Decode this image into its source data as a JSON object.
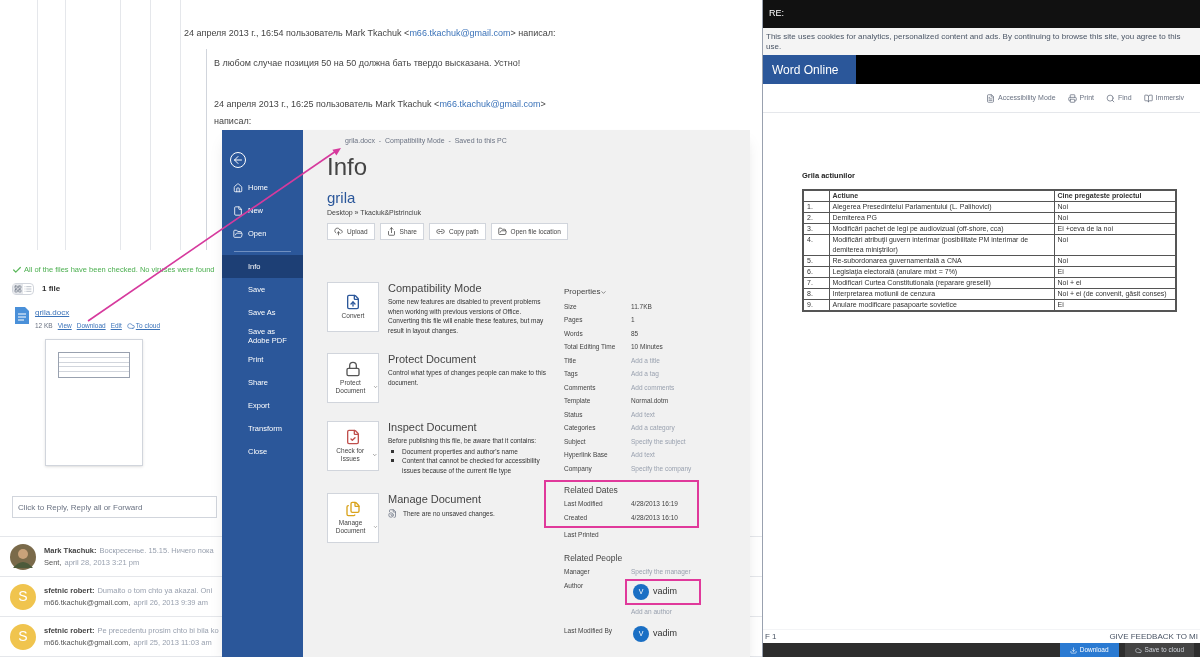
{
  "email_thread": {
    "header_1": {
      "prefix": "24 апреля 2013 г., 16:54 пользователь Mark Tkachuk <",
      "link": "m66.tkachuk@gmail.com",
      "suffix": "> написал:"
    },
    "quote": "В любом случае позиция 50 на 50 должна бать твердо высказана. Устно!",
    "header_2": {
      "prefix": "24 апреля 2013 г., 16:25 пользователь Mark Tkachuk <",
      "link": "m66.tkachuk@gmail.com",
      "suffix": ">"
    },
    "header_2_tail": "написал:"
  },
  "attachments": {
    "scan_notice": "All of the files have been checked. No viruses were found",
    "count": "1 file",
    "files": [
      {
        "name": "grila.docx",
        "size": "12 KB",
        "actions": [
          {
            "label": "View",
            "kind": "link"
          },
          {
            "label": "Download",
            "kind": "link"
          },
          {
            "label": "Edit",
            "kind": "link"
          },
          {
            "label": "To cloud",
            "kind": "cloud"
          }
        ]
      }
    ]
  },
  "reply": {
    "placeholder": "Click to Reply, Reply all or Forward"
  },
  "messages": [
    {
      "sender": "Mark Tkachuk:",
      "snippet": "Воскресенье. 15.15. Ничего пока",
      "meta_label": "Sent,",
      "date": "april 28, 2013 3:21 pm",
      "avatar": {
        "kind": "photo"
      }
    },
    {
      "sender": "sfetnic robert:",
      "snippet": "Dumaito o tom chto ya akazal. Oni",
      "meta_label": "m66.tkachuk@gmail.com,",
      "date": "april 26, 2013 9:39 am",
      "avatar": {
        "kind": "letter",
        "letter": "S"
      }
    },
    {
      "sender": "sfetnic robert:",
      "snippet": "Pe precedentu prosim chto bi bila ko",
      "meta_label": "m66.tkachuk@gmail.com,",
      "date": "april 25, 2013 11:03 am",
      "avatar": {
        "kind": "letter",
        "letter": "S"
      }
    }
  ],
  "backstage": {
    "title_bar": "grila.docx  -  Compatibility Mode  -  Saved to this PC",
    "nav_top": [
      {
        "label": "Home"
      },
      {
        "label": "New"
      },
      {
        "label": "Open"
      }
    ],
    "nav": [
      {
        "label": "Info",
        "selected": true
      },
      {
        "label": "Save",
        "selected": false
      },
      {
        "label": "Save As",
        "selected": false
      },
      {
        "label": "Save as Adobe PDF",
        "selected": false
      },
      {
        "label": "Print",
        "selected": false
      },
      {
        "label": "Share",
        "selected": false
      },
      {
        "label": "Export",
        "selected": false
      },
      {
        "label": "Transform",
        "selected": false
      },
      {
        "label": "Close",
        "selected": false
      }
    ],
    "heading": "Info",
    "doc_name": "grila",
    "path": "Desktop » Tkaciuk&Pistrinciuk",
    "actions": [
      {
        "label": "Upload"
      },
      {
        "label": "Share"
      },
      {
        "label": "Copy path"
      },
      {
        "label": "Open file location"
      }
    ],
    "sections": [
      {
        "kind": "convert",
        "button_label": "Convert",
        "has_menu": false,
        "title": "Compatibility Mode",
        "body": "Some new features are disabled to prevent problems when working with previous versions of Office. Converting this file will enable these features, but may result in layout changes."
      },
      {
        "kind": "protect",
        "button_label": "Protect Document",
        "has_menu": true,
        "title": "Protect Document",
        "body": "Control what types of changes people can make to this document."
      },
      {
        "kind": "inspect",
        "button_label": "Check for Issues",
        "has_menu": true,
        "title": "Inspect Document",
        "body": "Before publishing this file, be aware that it contains:",
        "bullets": [
          "Document properties and author's name",
          "Content that cannot be checked for accessibility issues because of the current file type"
        ]
      },
      {
        "kind": "manage",
        "button_label": "Manage Document",
        "has_menu": true,
        "title": "Manage Document",
        "note": "There are no unsaved changes."
      }
    ],
    "properties": {
      "heading": "Properties",
      "has_menu": true,
      "rows": [
        {
          "label": "Size",
          "value": "11.7KB",
          "empty": false
        },
        {
          "label": "Pages",
          "value": "1",
          "empty": false
        },
        {
          "label": "Words",
          "value": "85",
          "empty": false
        },
        {
          "label": "Total Editing Time",
          "value": "10 Minutes",
          "empty": false
        },
        {
          "label": "Title",
          "value": "Add a title",
          "empty": true
        },
        {
          "label": "Tags",
          "value": "Add a tag",
          "empty": true
        },
        {
          "label": "Comments",
          "value": "Add comments",
          "empty": true
        },
        {
          "label": "Template",
          "value": "Normal.dotm",
          "empty": false
        },
        {
          "label": "Status",
          "value": "Add text",
          "empty": true
        },
        {
          "label": "Categories",
          "value": "Add a category",
          "empty": true
        },
        {
          "label": "Subject",
          "value": "Specify the subject",
          "empty": true
        },
        {
          "label": "Hyperlink Base",
          "value": "Add text",
          "empty": true
        },
        {
          "label": "Company",
          "value": "Specify the company",
          "empty": true
        }
      ]
    },
    "related_dates": {
      "heading": "Related Dates",
      "highlighted": true,
      "rows": [
        {
          "label": "Last Modified",
          "value": "4/28/2013 16:19"
        },
        {
          "label": "Created",
          "value": "4/28/2013 16:10"
        }
      ],
      "last_printed": "Last Printed"
    },
    "related_people": {
      "heading": "Related People",
      "manager_label": "Manager",
      "manager_value": "Specify the manager",
      "author_label": "Author",
      "author": {
        "initial": "V",
        "name": "vadim",
        "highlighted": true
      },
      "add_author": "Add an author",
      "modified_by_label": "Last Modified By",
      "modified_by": {
        "initial": "V",
        "name": "vadim"
      }
    }
  },
  "word_online": {
    "title": "RE:",
    "cookie_notice": "This site uses cookies for analytics, personalized content and ads. By continuing to browse this site, you agree to this use.",
    "brand": "Word Online",
    "toolbar": [
      {
        "label": "Accessibility Mode"
      },
      {
        "label": "Print"
      },
      {
        "label": "Find"
      },
      {
        "label": "Immersiv"
      }
    ],
    "document": {
      "title": "Grila actiunilor",
      "columns": [
        "Actiune",
        "Cine pregateste proiectul"
      ],
      "rows": [
        {
          "number": "1.",
          "action": "Alegerea Presedintelui Parlamentului (L. Palihovici)",
          "who": "Noi"
        },
        {
          "number": "2.",
          "action": "Demiterea PG",
          "who": "Noi"
        },
        {
          "number": "3.",
          "action": "Modificări pachet de legi pe audiovizual (off-shore, cca)",
          "who": "Ei +ceva de la noi"
        },
        {
          "number": "4.",
          "action": "Modificări atribuţii guvern interimar (posibilitate PM interimar de demiterea miniştrilor)",
          "who": "Noi"
        },
        {
          "number": "5.",
          "action": "Re-subordonarea guvernamentală a CNA",
          "who": "Noi"
        },
        {
          "number": "6.",
          "action": "Legislaţia electorală (anulare mixt = 7%)",
          "who": "Ei"
        },
        {
          "number": "7.",
          "action": "Modificari Curtea Constitutionala (reparare greselii)",
          "who": "Noi + ei"
        },
        {
          "number": "8.",
          "action": "Interpretarea motiunii de cenzura",
          "who": "Noi + ei (de convenit, găsit conses)"
        },
        {
          "number": "9.",
          "action": "Anulare modificare pasapoarte sovietice",
          "who": "Ei"
        }
      ]
    },
    "page_info": "F 1",
    "feedback": "GIVE FEEDBACK TO MI",
    "bottom_actions": [
      "Download",
      "Save to cloud"
    ]
  }
}
